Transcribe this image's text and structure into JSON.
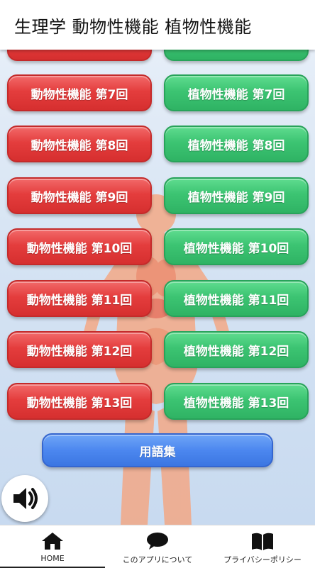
{
  "appbar": {
    "title": "生理学 動物性機能 植物性機能"
  },
  "buttons": {
    "animal": [
      "動物性機能 第7回",
      "動物性機能 第8回",
      "動物性機能 第9回",
      "動物性機能 第10回",
      "動物性機能 第11回",
      "動物性機能 第12回",
      "動物性機能 第13回"
    ],
    "plant": [
      "植物性機能 第7回",
      "植物性機能 第8回",
      "植物性機能 第9回",
      "植物性機能 第10回",
      "植物性機能 第11回",
      "植物性機能 第12回",
      "植物性機能 第13回"
    ],
    "glossary": "用語集"
  },
  "nav": {
    "home": "HOME",
    "about": "このアプリについて",
    "privacy": "プライバシーポリシー"
  },
  "colors": {
    "red": "#e43d3d",
    "green": "#3cc472",
    "blue": "#4c87ef"
  },
  "icons": {
    "speaker": "speaker-icon",
    "home": "home-icon",
    "about": "chat-bubble-icon",
    "privacy": "book-icon"
  }
}
